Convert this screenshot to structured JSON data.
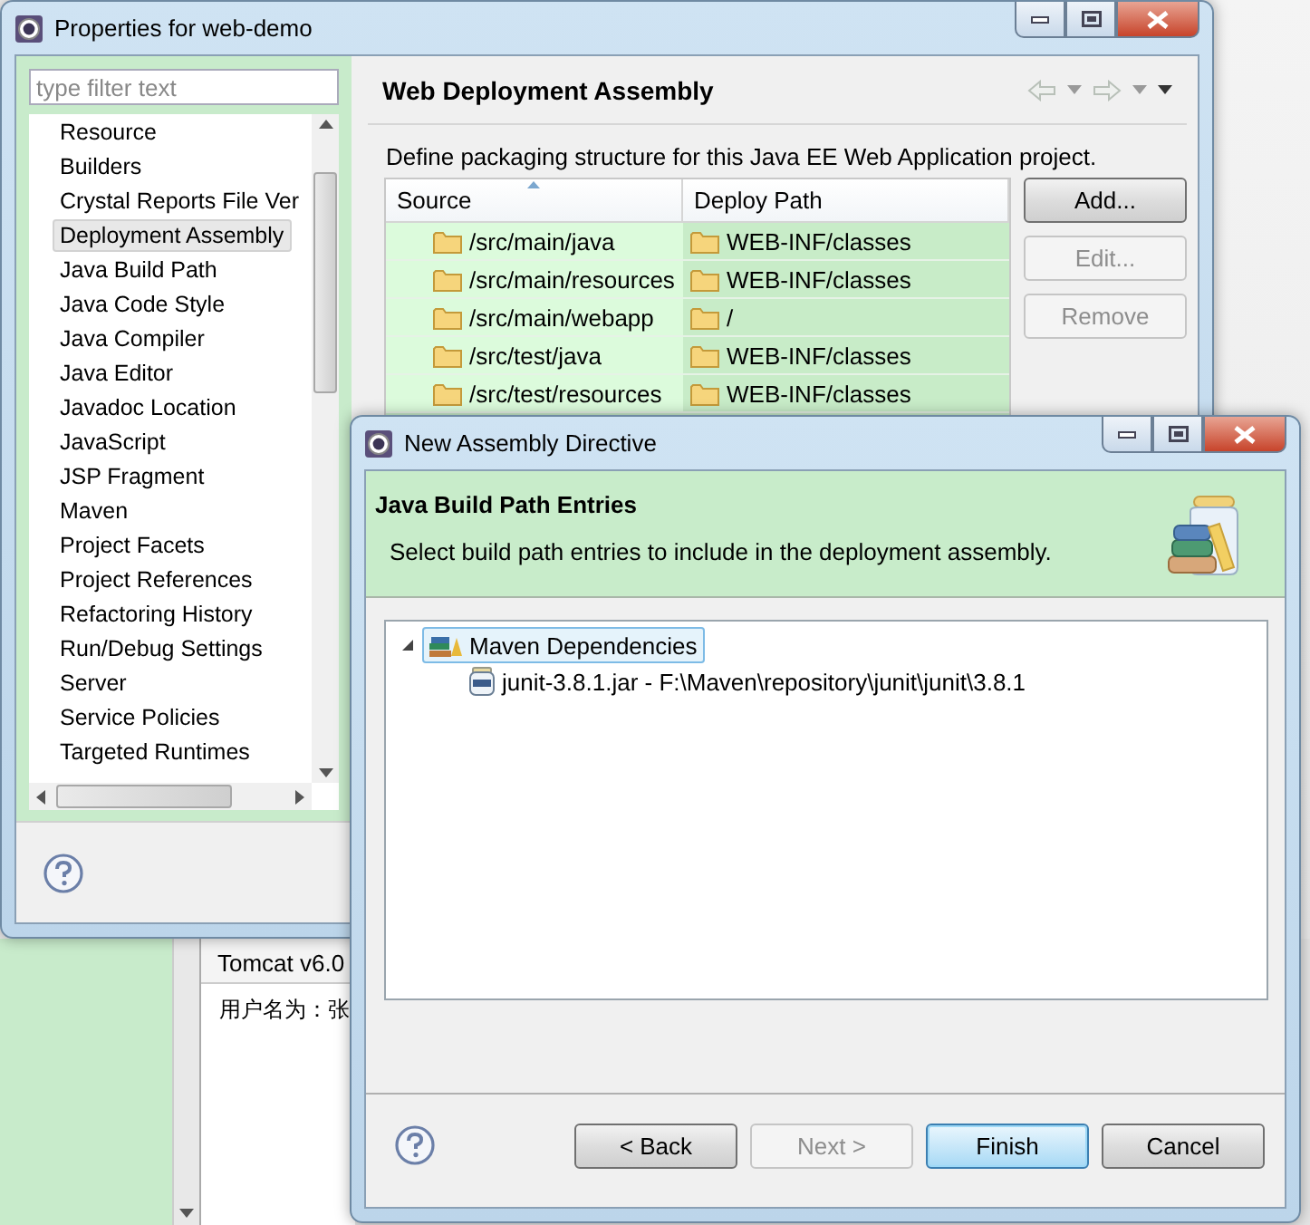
{
  "properties_window": {
    "title": "Properties for web-demo",
    "filter": {
      "placeholder": "type filter text"
    },
    "nav_items": [
      {
        "label": "Resource",
        "selected": false
      },
      {
        "label": "Builders",
        "selected": false
      },
      {
        "label": "Crystal Reports File Ver",
        "selected": false
      },
      {
        "label": "Deployment Assembly",
        "selected": true
      },
      {
        "label": "Java Build Path",
        "selected": false
      },
      {
        "label": "Java Code Style",
        "selected": false
      },
      {
        "label": "Java Compiler",
        "selected": false
      },
      {
        "label": "Java Editor",
        "selected": false
      },
      {
        "label": "Javadoc Location",
        "selected": false
      },
      {
        "label": "JavaScript",
        "selected": false
      },
      {
        "label": "JSP Fragment",
        "selected": false
      },
      {
        "label": "Maven",
        "selected": false
      },
      {
        "label": "Project Facets",
        "selected": false
      },
      {
        "label": "Project References",
        "selected": false
      },
      {
        "label": "Refactoring History",
        "selected": false
      },
      {
        "label": "Run/Debug Settings",
        "selected": false
      },
      {
        "label": "Server",
        "selected": false
      },
      {
        "label": "Service Policies",
        "selected": false
      },
      {
        "label": "Targeted Runtimes",
        "selected": false
      }
    ],
    "page": {
      "title": "Web Deployment Assembly",
      "description": "Define packaging structure for this Java EE Web Application project.",
      "columns": [
        "Source",
        "Deploy Path"
      ],
      "rows": [
        {
          "source": "/src/main/java",
          "deploy_path": "WEB-INF/classes"
        },
        {
          "source": "/src/main/resources",
          "deploy_path": "WEB-INF/classes"
        },
        {
          "source": "/src/main/webapp",
          "deploy_path": "/"
        },
        {
          "source": "/src/test/java",
          "deploy_path": "WEB-INF/classes"
        },
        {
          "source": "/src/test/resources",
          "deploy_path": "WEB-INF/classes"
        }
      ],
      "buttons": [
        {
          "label": "Add...",
          "disabled": false
        },
        {
          "label": "Edit...",
          "disabled": true
        },
        {
          "label": "Remove",
          "disabled": true
        }
      ]
    }
  },
  "console": {
    "tab": "Tomcat v6.0",
    "line": "用户名为：张"
  },
  "dialog": {
    "title": "New Assembly Directive",
    "heading": "Java Build Path Entries",
    "message": "Select build path entries to include in the deployment assembly.",
    "tree": [
      {
        "label": "Maven Dependencies",
        "kind": "library",
        "expanded": true,
        "selected": true,
        "children": [
          {
            "label": "junit-3.8.1.jar - F:\\Maven\\repository\\junit\\junit\\3.8.1",
            "kind": "jar",
            "selected": false
          }
        ]
      }
    ],
    "buttons": [
      {
        "label": "< Back",
        "disabled": false,
        "default": false
      },
      {
        "label": "Next >",
        "disabled": true,
        "default": false
      },
      {
        "label": "Finish",
        "disabled": false,
        "default": true
      },
      {
        "label": "Cancel",
        "disabled": false,
        "default": false
      }
    ]
  }
}
